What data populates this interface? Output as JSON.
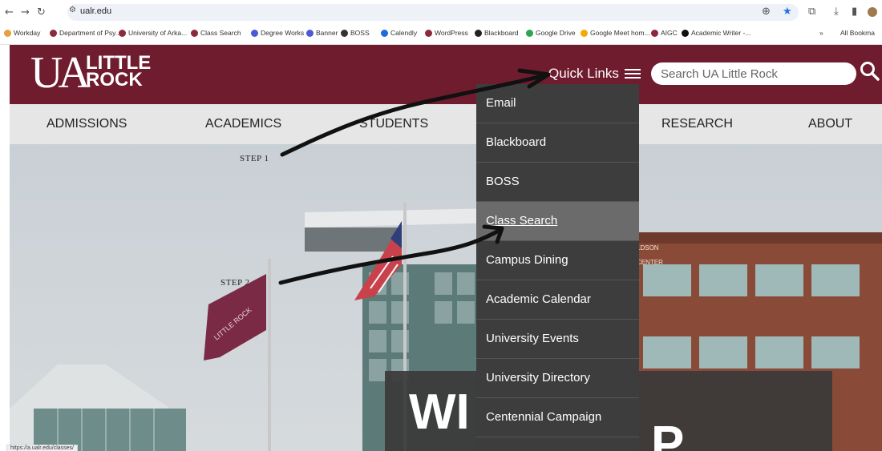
{
  "browser": {
    "url": "ualr.edu",
    "status_url": "https://a.ualr.edu/classes/",
    "bookmarks": [
      {
        "label": "Workday",
        "color": "#e5a23b"
      },
      {
        "label": "Department of Psy...",
        "color": "#8b2a3a"
      },
      {
        "label": "University of Arka...",
        "color": "#8b2a3a"
      },
      {
        "label": "Class Search",
        "color": "#8b2a3a"
      },
      {
        "label": "Degree Works",
        "color": "#4a5bd8"
      },
      {
        "label": "Banner",
        "color": "#4a5bd8"
      },
      {
        "label": "BOSS",
        "color": "#333333"
      },
      {
        "label": "Calendly",
        "color": "#1f6bde"
      },
      {
        "label": "WordPress",
        "color": "#8b2a3a"
      },
      {
        "label": "Blackboard",
        "color": "#222222"
      },
      {
        "label": "Google Drive",
        "color": "#2ea44f"
      },
      {
        "label": "Google Meet hom...",
        "color": "#f2a900"
      },
      {
        "label": "AIGC",
        "color": "#8b2a3a"
      },
      {
        "label": "Academic Writer -...",
        "color": "#111111"
      }
    ],
    "bookmarks_overflow": "»",
    "all_bookmarks": "All Bookma"
  },
  "site": {
    "logo_ua": "UA",
    "logo_line1": "LITTLE",
    "logo_line2": "ROCK",
    "quick_links_label": "Quick Links",
    "search_placeholder": "Search UA Little Rock",
    "brand_color": "#6f1c2f"
  },
  "nav": {
    "items": [
      "ADMISSIONS",
      "ACADEMICS",
      "STUDENTS",
      "RESEARCH",
      "ABOUT"
    ]
  },
  "quick_links": {
    "items": [
      "Email",
      "Blackboard",
      "BOSS",
      "Class Search",
      "Campus Dining",
      "Academic Calendar",
      "University Events",
      "University Directory",
      "Centennial Campaign"
    ],
    "active_item": "Class Search"
  },
  "annotations": {
    "step1": "STEP 1",
    "step2": "STEP 2"
  },
  "hero": {
    "sign_text": "LDSON\nCENTER",
    "flag_text": "LITTLE\nROCK",
    "headline_partial": "WI"
  }
}
